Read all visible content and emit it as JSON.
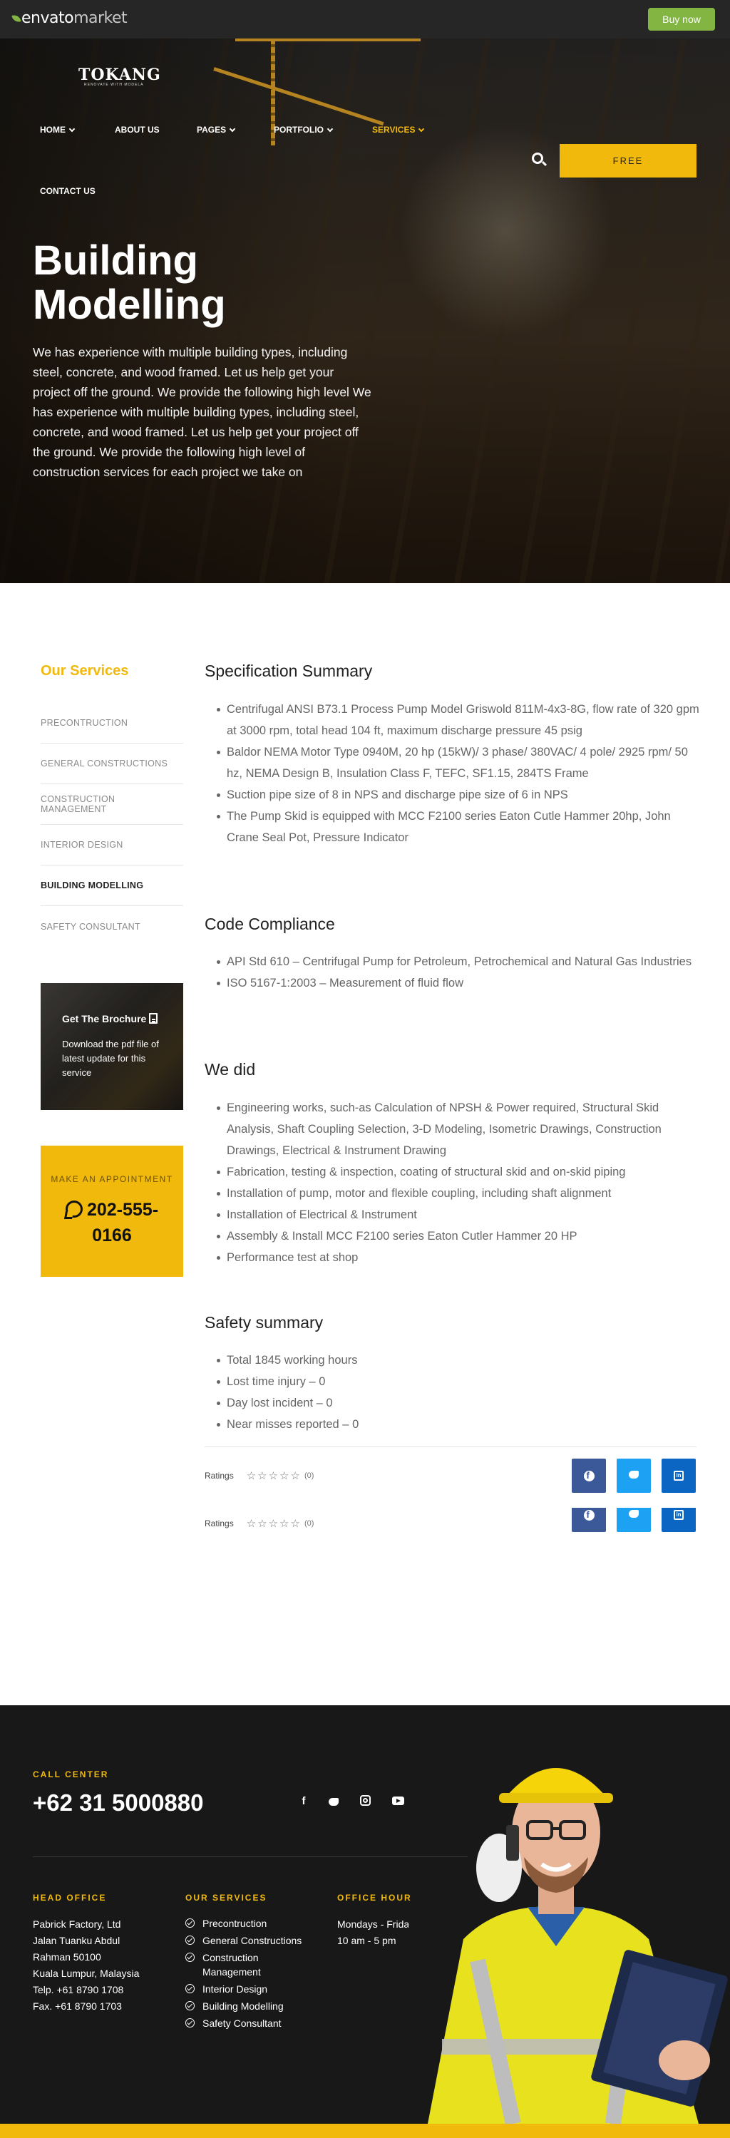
{
  "envato": {
    "logo_main": "envato",
    "logo_market": "market",
    "buy_now": "Buy now"
  },
  "brand": {
    "logo": "TOKANG",
    "tagline": "RENOVATE WITH MODELA"
  },
  "nav": {
    "items": [
      "HOME",
      "ABOUT US",
      "PAGES",
      "PORTFOLIO",
      "SERVICES",
      "CONTACT US"
    ],
    "active": "SERVICES",
    "free_button": "FREE"
  },
  "hero": {
    "title": "Building Modelling",
    "description": "We has experience with multiple building types, including steel, concrete, and wood framed. Let us help get your project off the ground. We provide the following high level We has experience with multiple building types, including steel, concrete, and wood framed. Let us help get your project off the ground. We provide the following high level of construction services for each project we take on"
  },
  "sidebar": {
    "title": "Our Services",
    "items": [
      "PRECONTRUCTION",
      "GENERAL CONSTRUCTIONS",
      "CONSTRUCTION MANAGEMENT",
      "INTERIOR DESIGN",
      "BUILDING MODELLING",
      "SAFETY CONSULTANT"
    ],
    "active": "BUILDING MODELLING"
  },
  "brochure": {
    "title": "Get The Brochure",
    "text": "Download the pdf file of latest update for this service"
  },
  "appointment": {
    "label": "MAKE AN APPOINTMENT",
    "phone": "202-555-0166"
  },
  "sections": [
    {
      "heading": "Specification Summary",
      "items": [
        "Centrifugal ANSI B73.1 Process Pump Model Griswold 811M-4x3-8G, flow rate of 320 gpm  at 3000 rpm, total head 104 ft, maximum discharge pressure 45 psig",
        "Baldor NEMA Motor Type 0940M, 20 hp (15kW)/ 3 phase/ 380VAC/ 4 pole/ 2925 rpm/ 50 hz, NEMA Design B, Insulation Class F, TEFC, SF1.15, 284TS Frame",
        "Suction pipe size of 8 in NPS and discharge pipe size of 6 in NPS",
        "The Pump Skid is equipped with MCC F2100 series Eaton Cutle Hammer 20hp, John Crane Seal Pot, Pressure Indicator"
      ]
    },
    {
      "heading": "Code Compliance",
      "items": [
        "API Std 610 – Centrifugal Pump for Petroleum, Petrochemical and Natural Gas Industries",
        "ISO 5167-1:2003 – Measurement of fluid flow"
      ]
    },
    {
      "heading": "We did",
      "items": [
        "Engineering works, such-as Calculation of NPSH & Power required, Structural Skid Analysis, Shaft Coupling Selection, 3-D Modeling, Isometric Drawings, Construction Drawings, Electrical & Instrument Drawing",
        "Fabrication, testing & inspection, coating of structural skid and on-skid piping",
        "Installation of pump, motor and flexible coupling, including shaft alignment",
        "Installation of Electrical & Instrument",
        "Assembly & Install MCC F2100 series Eaton Cutler Hammer 20 HP",
        "Performance test at shop"
      ]
    },
    {
      "heading": "Safety summary",
      "items": [
        "Total 1845 working hours",
        "Lost time injury – 0",
        "Day lost incident – 0",
        "Near misses reported – 0"
      ]
    }
  ],
  "ratings": {
    "label": "Ratings",
    "stars": "☆☆☆☆☆",
    "count": "(0)",
    "value": 0
  },
  "footer": {
    "call_center_label": "CALL CENTER",
    "call_center_number": "+62 31 5000880",
    "head_office_label": "HEAD OFFICE",
    "head_office_lines": [
      "Pabrick Factory, Ltd",
      "Jalan Tuanku Abdul",
      "Rahman 50100",
      "Kuala Lumpur, Malaysia",
      "Telp. +61 8790 1708",
      "Fax. +61 8790 1703"
    ],
    "services_label": "OUR SERVICES",
    "services": [
      "Precontruction",
      "General Constructions",
      "Construction Management",
      "Interior Design",
      "Building Modelling",
      "Safety Consultant"
    ],
    "office_hour_label": "OFFICE HOUR",
    "office_hour_lines": [
      "Mondays - Friday",
      "10 am - 5 pm"
    ]
  },
  "colors": {
    "accent": "#f0b90b",
    "envato_green": "#82b541",
    "footer_bg": "#181818",
    "facebook": "#3b5998",
    "twitter": "#1da1f2",
    "linkedin": "#0a66c2"
  }
}
